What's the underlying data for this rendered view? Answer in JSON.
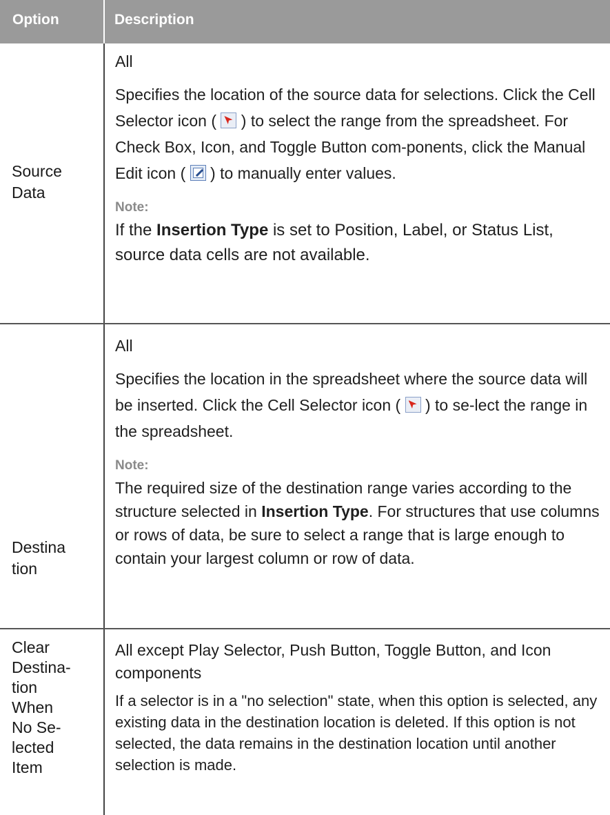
{
  "header": {
    "option": "Option",
    "description": "Description"
  },
  "rows": [
    {
      "option_lines": [
        "Source",
        "Data"
      ],
      "applies": "All",
      "description": {
        "t1": "Specifies the location of the source data for selections. Click the Cell Selector icon (",
        "t2": ") to select the range from the spreadsheet. For Check Box, Icon, and Toggle Button com-ponents, click the Manual Edit icon (",
        "t3": ") to manually enter values."
      },
      "note_label": "Note:",
      "note": {
        "pre": "If the ",
        "bold": "Insertion Type",
        "post": " is set to Position, Label, or Status List, source data cells are not available."
      }
    },
    {
      "option_lines": [
        "Destina",
        "tion"
      ],
      "applies": "All",
      "description": {
        "t1": "Specifies the location in the spreadsheet where the source data will be inserted. Click the Cell Selector icon (",
        "t2": ") to se-lect the range in the spreadsheet."
      },
      "note_label": "Note:",
      "note": {
        "pre": "The required size of the destination range varies according to the structure selected in ",
        "bold": "Insertion Type",
        "post": ". For structures that use columns or rows of data, be sure to select a range that is large enough to contain your largest column or row of data."
      }
    },
    {
      "option_lines": [
        "Clear",
        "Destina-",
        "tion",
        "When",
        "No Se-",
        "lected",
        "Item"
      ],
      "applies": "All except Play Selector, Push Button, Toggle Button, and Icon components",
      "description": {
        "t1": "If a selector is in a \"no selection\" state, when this option is selected, any existing data in the destination location is deleted. If this option is not selected, the data remains in the destination location until another selection is made."
      }
    }
  ],
  "icons": {
    "cell_selector": "cell-selector-icon",
    "manual_edit": "manual-edit-icon"
  },
  "colors": {
    "header_bg": "#9a9a9a",
    "header_text": "#ffffff",
    "note_label": "#8a8a8a"
  }
}
